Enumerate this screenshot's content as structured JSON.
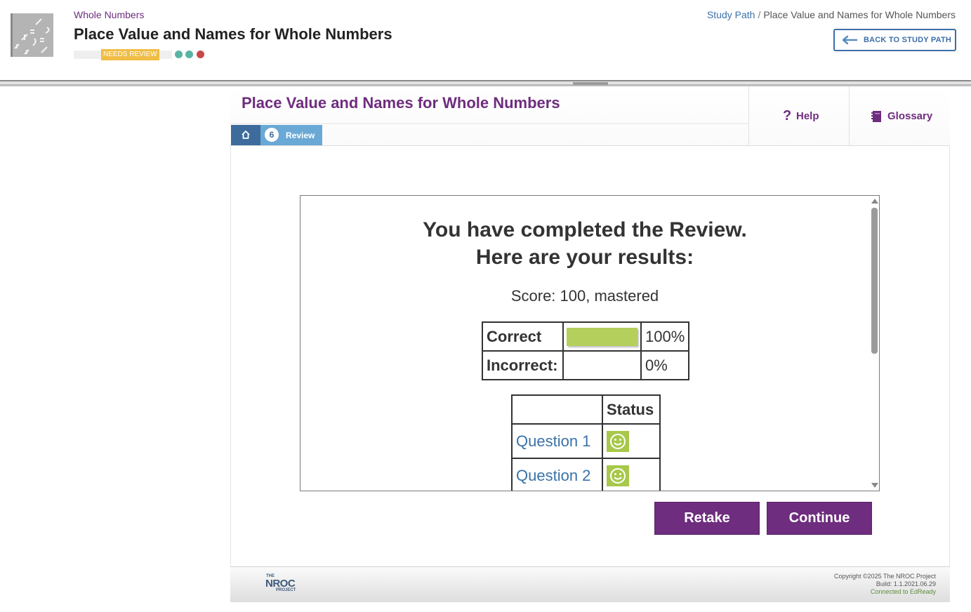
{
  "header": {
    "subject": "Whole Numbers",
    "title": "Place Value and Names for Whole Numbers",
    "status_badge": "NEEDS REVIEW",
    "status_dots": [
      "#5ab4a3",
      "#5ab4a3",
      "#c84848"
    ],
    "breadcrumb": {
      "root": "Study Path",
      "separator": "/",
      "current": "Place Value and Names for Whole Numbers"
    },
    "back_button": "BACK TO STUDY PATH"
  },
  "lesson": {
    "title": "Place Value and Names for Whole Numbers",
    "tabs": {
      "review_number": "6",
      "review_label": "Review"
    },
    "help_label": "Help",
    "glossary_label": "Glossary"
  },
  "results": {
    "heading_line1": "You have completed the Review.",
    "heading_line2": "Here are your results:",
    "score_text": "Score: 100, mastered",
    "correct_label": "Correct",
    "correct_pct": "100%",
    "correct_fraction": 1.0,
    "incorrect_label": "Incorrect:",
    "incorrect_pct": "0%",
    "status_header": "Status",
    "questions": [
      {
        "label": "Question 1",
        "status": "correct"
      },
      {
        "label": "Question 2",
        "status": "correct"
      }
    ]
  },
  "actions": {
    "retake": "Retake",
    "continue": "Continue"
  },
  "footer": {
    "logo_top": "THE",
    "logo_main": "NROC",
    "logo_bottom": "PROJECT",
    "copyright": "Copyright ©2025 The NROC Project",
    "build": "Build: 1.1.2021.06.29",
    "connected": "Connected to EdReady"
  },
  "colors": {
    "brand_purple": "#6e2d7e",
    "link_blue": "#3b72a8",
    "tab_dark": "#3d6b9c",
    "tab_light": "#6aa8d6",
    "success_green": "#b4cf5c",
    "badge_yellow": "#f0bd45"
  }
}
